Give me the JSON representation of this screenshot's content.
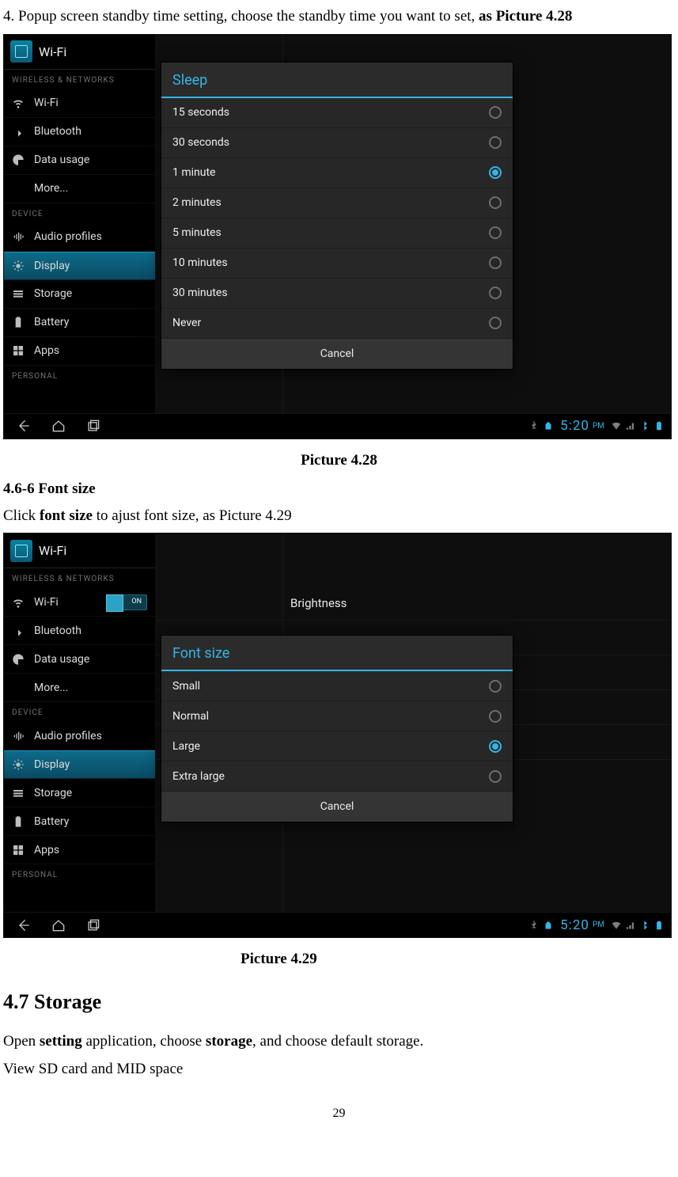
{
  "doc": {
    "intro_prefix": "4. Popup screen standby time setting, choose the standby time you want to set, ",
    "intro_bold": "as Picture 4.28",
    "caption1": "Picture 4.28",
    "section466": "4.6-6 Font size",
    "fontsize_sentence_pre": "Click ",
    "fontsize_sentence_bold": "font size",
    "fontsize_sentence_post": " to ajust font size, as Picture 4.29",
    "caption2": "Picture 4.29",
    "h2": "4.7 Storage",
    "storage_line1_pre": "Open ",
    "storage_line1_b1": "setting",
    "storage_line1_mid": " application, choose ",
    "storage_line1_b2": "storage",
    "storage_line1_post": ", and choose default storage.",
    "storage_line2": "View SD card and MID space",
    "page_number": "29"
  },
  "settings": {
    "app_title": "Wi-Fi",
    "cat_wireless": "WIRELESS & NETWORKS",
    "cat_device": "DEVICE",
    "cat_personal": "PERSONAL",
    "items": {
      "wifi": "Wi-Fi",
      "bluetooth": "Bluetooth",
      "data": "Data usage",
      "more": "More...",
      "audio": "Audio profiles",
      "display": "Display",
      "storage": "Storage",
      "battery": "Battery",
      "apps": "Apps"
    }
  },
  "sleep_dialog": {
    "title": "Sleep",
    "options": [
      {
        "label": "15 seconds",
        "selected": false
      },
      {
        "label": "30 seconds",
        "selected": false
      },
      {
        "label": "1 minute",
        "selected": true
      },
      {
        "label": "2 minutes",
        "selected": false
      },
      {
        "label": "5 minutes",
        "selected": false
      },
      {
        "label": "10 minutes",
        "selected": false
      },
      {
        "label": "30 minutes",
        "selected": false
      },
      {
        "label": "Never",
        "selected": false
      }
    ],
    "cancel": "Cancel"
  },
  "font_dialog": {
    "content_row_label": "Brightness",
    "title": "Font size",
    "options": [
      {
        "label": "Small",
        "selected": false
      },
      {
        "label": "Normal",
        "selected": false
      },
      {
        "label": "Large",
        "selected": true
      },
      {
        "label": "Extra large",
        "selected": false
      }
    ],
    "cancel": "Cancel"
  },
  "statusbar": {
    "time": "5:20",
    "ampm": "PM"
  }
}
